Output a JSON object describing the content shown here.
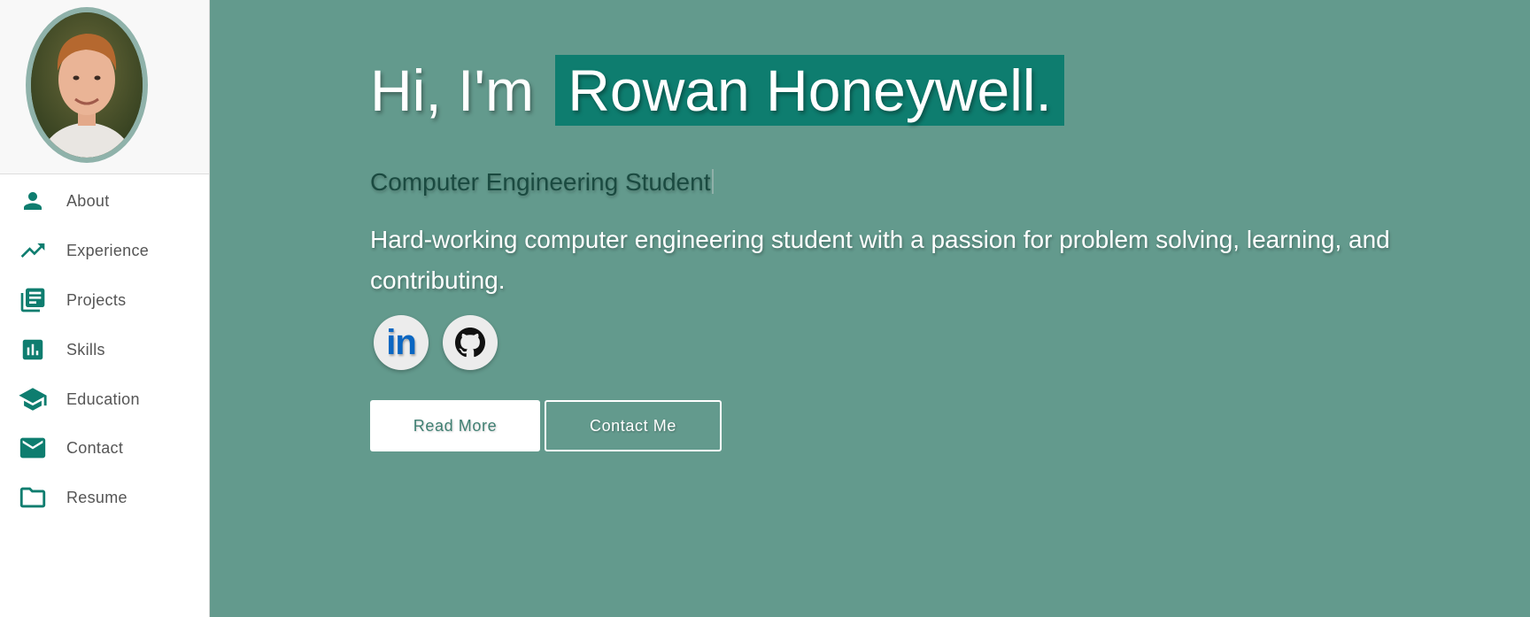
{
  "sidebar": {
    "items": [
      {
        "label": "About",
        "icon": "person-icon"
      },
      {
        "label": "Experience",
        "icon": "trending-up-icon"
      },
      {
        "label": "Projects",
        "icon": "library-books-icon"
      },
      {
        "label": "Skills",
        "icon": "bar-chart-icon"
      },
      {
        "label": "Education",
        "icon": "school-icon"
      },
      {
        "label": "Contact",
        "icon": "mail-icon"
      },
      {
        "label": "Resume",
        "icon": "folder-icon"
      }
    ]
  },
  "hero": {
    "greeting": "Hi, I'm",
    "name": "Rowan Honeywell.",
    "role": "Computer Engineering Student",
    "bio": "Hard-working computer engineering student with a passion for problem solving, learning, and contributing.",
    "read_more_label": "Read More",
    "contact_label": "Contact Me"
  },
  "social": {
    "linkedin_text": "in"
  },
  "colors": {
    "accent": "#0e7d6f",
    "hero_background": "#639a8d",
    "icon": "#0e7d6f",
    "linkedin": "#0a66c2"
  }
}
